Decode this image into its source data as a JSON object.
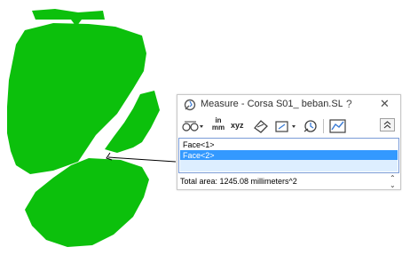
{
  "window": {
    "title": "Measure - Corsa S01_ beban.SL...",
    "help_label": "?",
    "close_label": "✕",
    "icon": "measure-icon"
  },
  "toolbar": {
    "buttons": [
      {
        "name": "arc-circle-options",
        "icon": "arc-options-icon"
      },
      {
        "name": "units-precision",
        "label_top": "in",
        "label_bottom": "mm"
      },
      {
        "name": "show-xyz",
        "label": "xyz"
      },
      {
        "name": "point-to-point",
        "icon": "point-to-point-icon"
      },
      {
        "name": "projected-on",
        "icon": "projection-icon"
      },
      {
        "name": "measure-history",
        "icon": "history-icon"
      },
      {
        "name": "create-sensor",
        "icon": "sensor-icon"
      }
    ],
    "collapse_label": "⌃"
  },
  "selection": {
    "items": [
      {
        "label": "Face<1>",
        "selected": false
      },
      {
        "label": "Face<2>",
        "selected": true
      }
    ]
  },
  "result": {
    "text": "Total area: 1245.08 millimeters^2"
  },
  "colors": {
    "part": "#0cc00c",
    "selection_highlight": "#3399ff",
    "dialog_bg": "#ffffff"
  }
}
